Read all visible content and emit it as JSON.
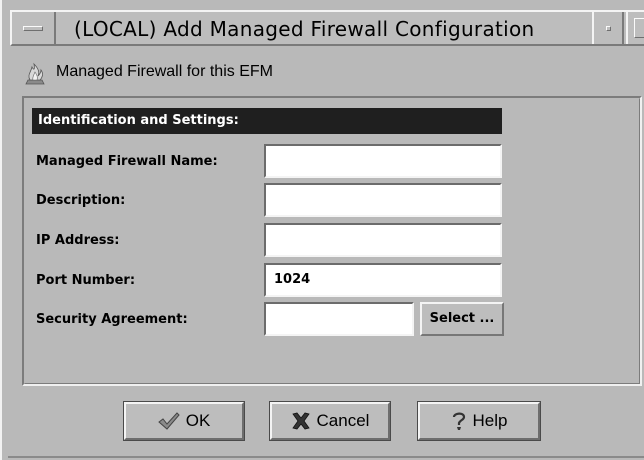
{
  "window": {
    "title": "(LOCAL) Add Managed Firewall Configuration"
  },
  "header": {
    "icon": "flame-icon",
    "text": "Managed Firewall for this EFM"
  },
  "section": {
    "title": "Identification and Settings:"
  },
  "fields": {
    "name": {
      "label": "Managed Firewall Name:",
      "value": ""
    },
    "description": {
      "label": "Description:",
      "value": ""
    },
    "ip": {
      "label": "IP Address:",
      "value": ""
    },
    "port": {
      "label": "Port Number:",
      "value": "1024"
    },
    "security": {
      "label": "Security Agreement:",
      "value": ""
    }
  },
  "select_button": {
    "label": "Select ..."
  },
  "buttons": {
    "ok": {
      "label": "OK",
      "icon": "checkmark-icon"
    },
    "cancel": {
      "label": "Cancel",
      "icon": "x-icon"
    },
    "help": {
      "label": "Help",
      "icon": "question-mark-icon"
    }
  },
  "colors": {
    "window_bg": "#b9b9b9",
    "section_header_bg": "#1f1f1f",
    "field_bg": "#ffffff"
  }
}
